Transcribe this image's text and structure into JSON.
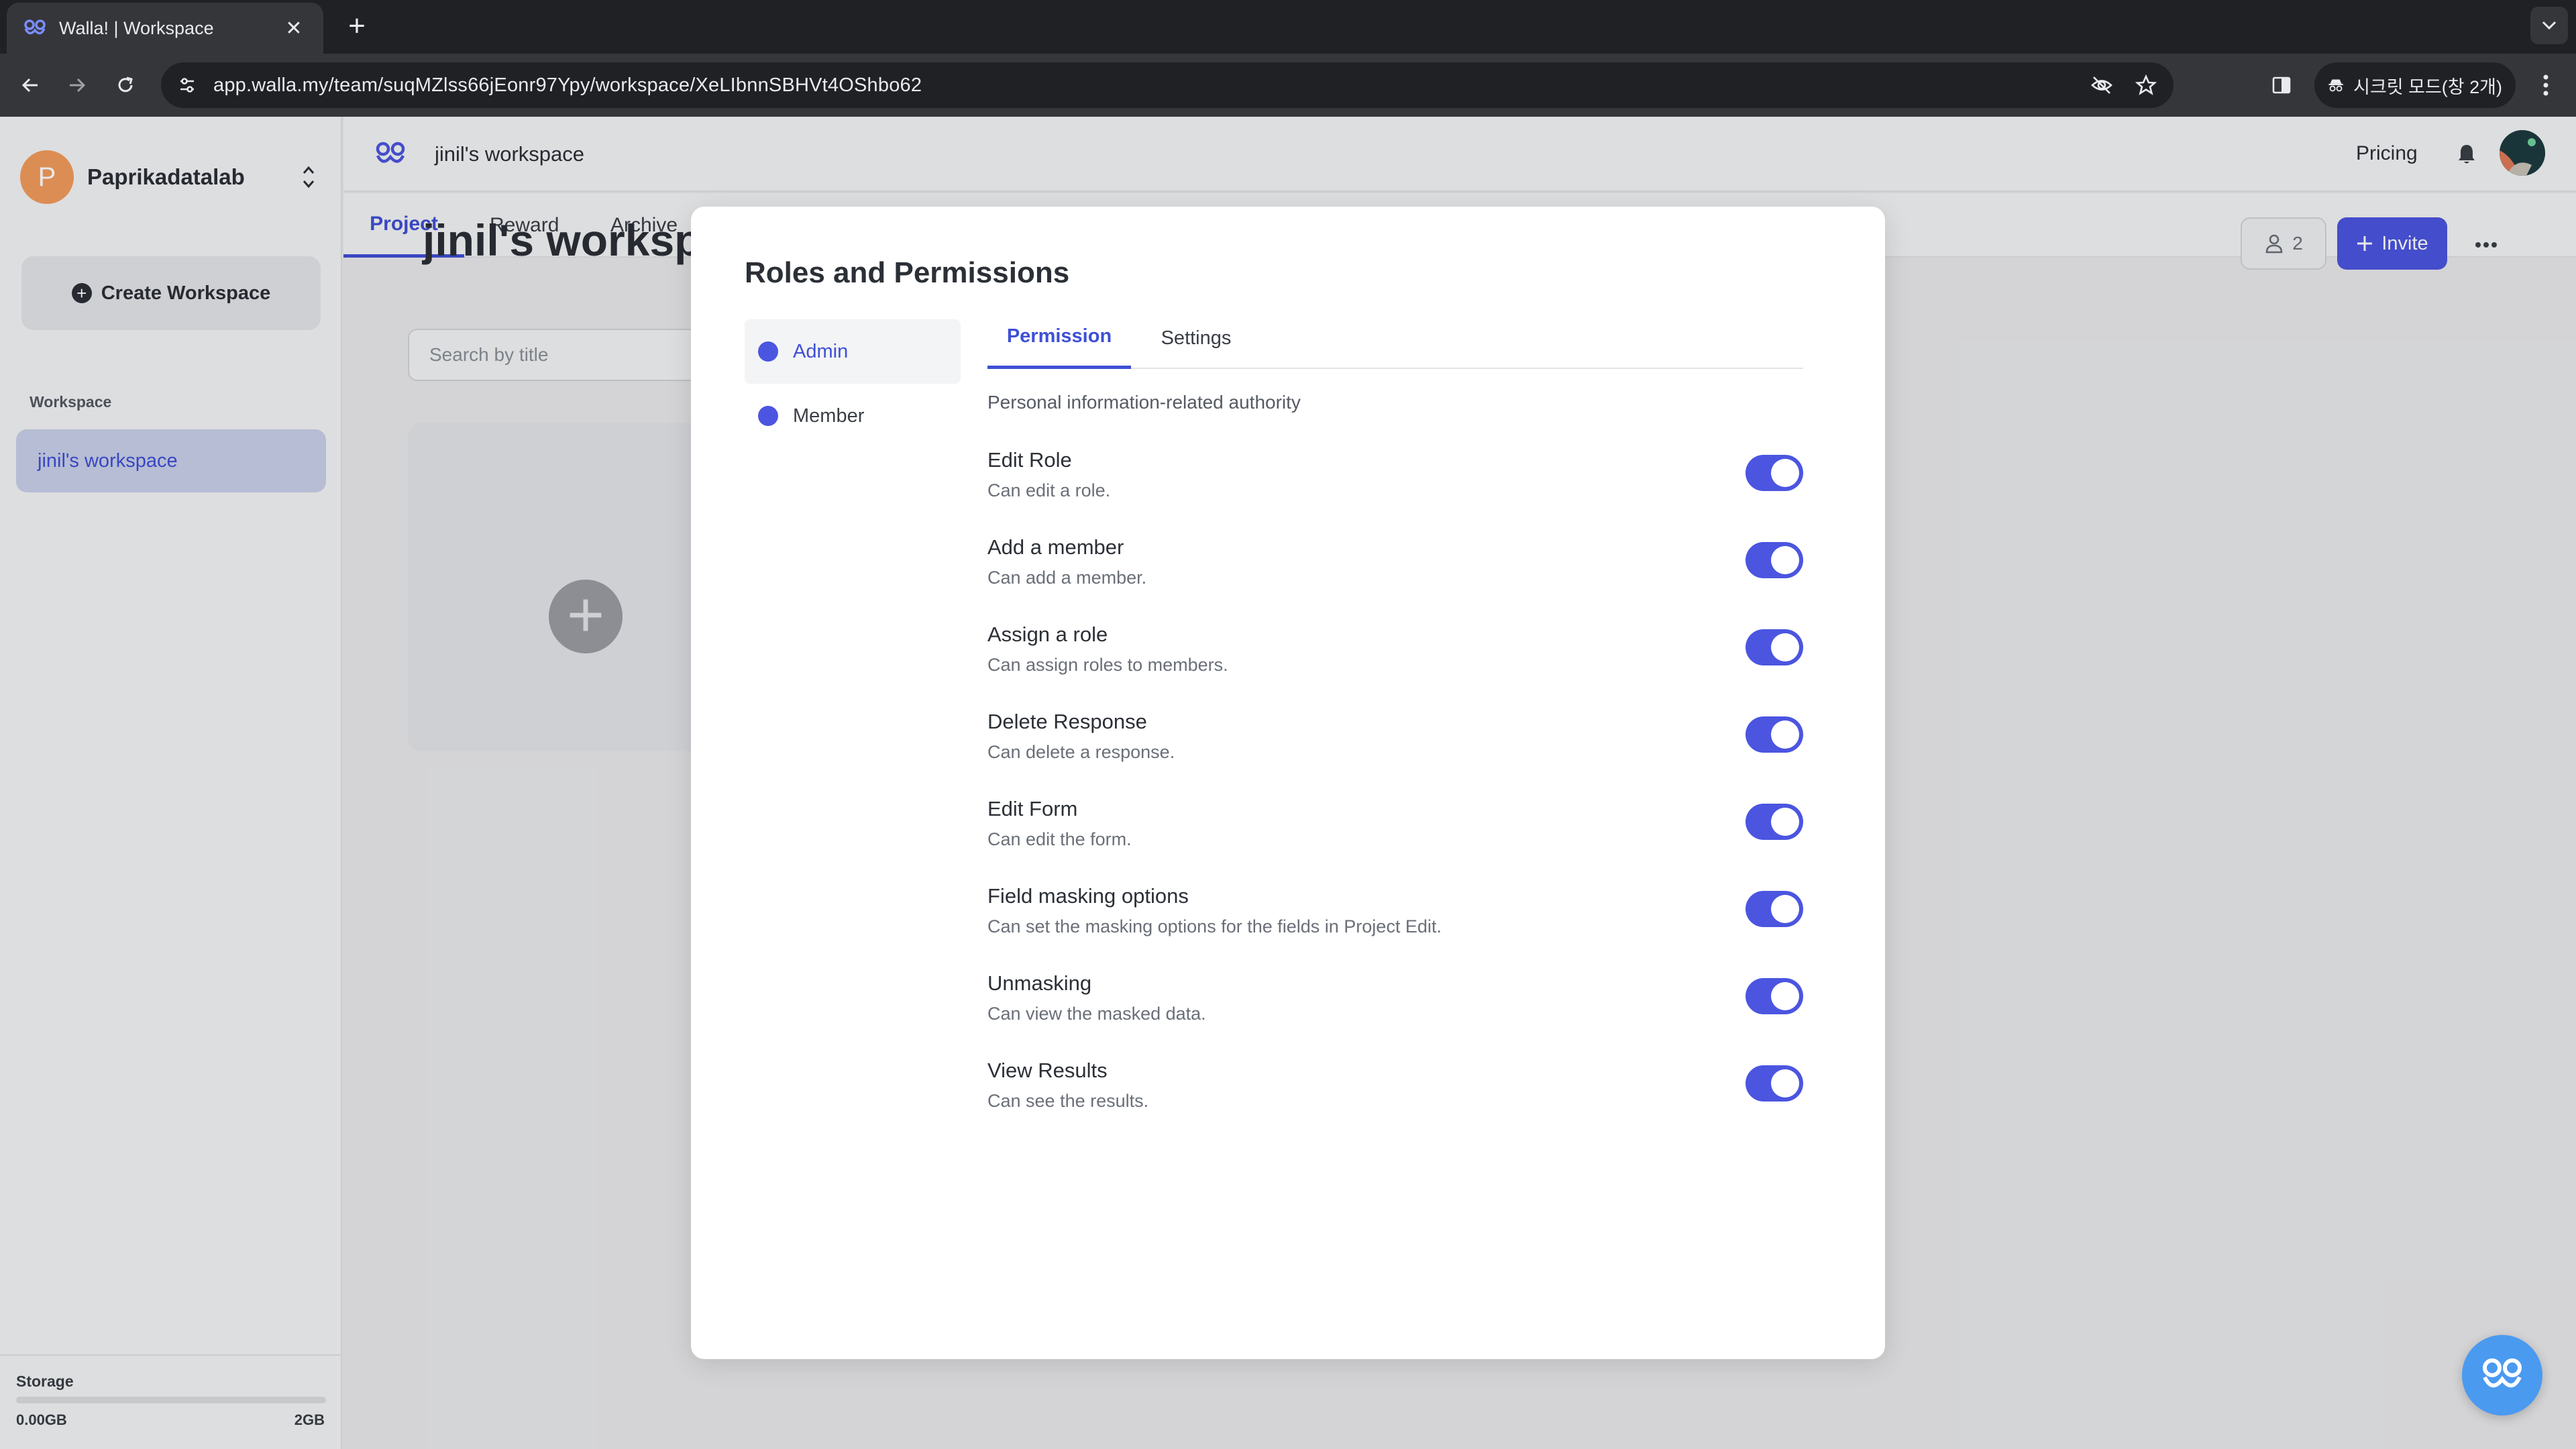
{
  "browser": {
    "tab_title": "Walla! | Workspace",
    "url": "app.walla.my/team/suqMZlss66jEonr97Ypy/workspace/XeLIbnnSBHVt4OShbo62",
    "incognito_label": "시크릿 모드(창 2개)"
  },
  "sidebar": {
    "org_initial": "P",
    "org_name": "Paprikadatalab",
    "create_workspace": "Create Workspace",
    "section_label": "Workspace",
    "workspaces": [
      {
        "label": "jinil's workspace"
      }
    ],
    "storage": {
      "label": "Storage",
      "used": "0.00GB",
      "total": "2GB"
    }
  },
  "header": {
    "workspace_title": "jinil's workspace",
    "pricing": "Pricing"
  },
  "tabs": [
    {
      "label": "Project",
      "active": true
    },
    {
      "label": "Reward",
      "active": false
    },
    {
      "label": "Archive",
      "active": false
    }
  ],
  "main": {
    "title": "jinil's workspace",
    "search_placeholder": "Search by title",
    "member_count": "2",
    "invite_label": "Invite"
  },
  "modal": {
    "title": "Roles and Permissions",
    "roles": [
      {
        "label": "Admin",
        "active": true
      },
      {
        "label": "Member",
        "active": false
      }
    ],
    "tabs": [
      {
        "label": "Permission",
        "active": true
      },
      {
        "label": "Settings",
        "active": false
      }
    ],
    "section_label": "Personal information-related authority",
    "permissions": [
      {
        "title": "Edit Role",
        "desc": "Can edit a role.",
        "enabled": true
      },
      {
        "title": "Add a member",
        "desc": "Can add a member.",
        "enabled": true
      },
      {
        "title": "Assign a role",
        "desc": "Can assign roles to members.",
        "enabled": true
      },
      {
        "title": "Delete Response",
        "desc": "Can delete a response.",
        "enabled": true
      },
      {
        "title": "Edit Form",
        "desc": "Can edit the form.",
        "enabled": true
      },
      {
        "title": "Field masking options",
        "desc": "Can set the masking options for the fields in Project Edit.",
        "enabled": true
      },
      {
        "title": "Unmasking",
        "desc": "Can view the masked data.",
        "enabled": true
      },
      {
        "title": "View Results",
        "desc": "Can see the results.",
        "enabled": true
      }
    ]
  },
  "colors": {
    "accent": "#4b55e0",
    "org_avatar": "#f29b5c",
    "fab": "#4a9af0"
  },
  "icons": [
    "walla-logo-icon",
    "tab-close-icon",
    "new-tab-icon",
    "back-icon",
    "forward-icon",
    "reload-icon",
    "site-info-icon",
    "eye-off-icon",
    "star-icon",
    "side-panel-icon",
    "incognito-icon",
    "chrome-menu-icon",
    "chevron-updown-icon",
    "plus-circle-icon",
    "bell-icon",
    "person-icon",
    "plus-icon",
    "more-icon"
  ]
}
